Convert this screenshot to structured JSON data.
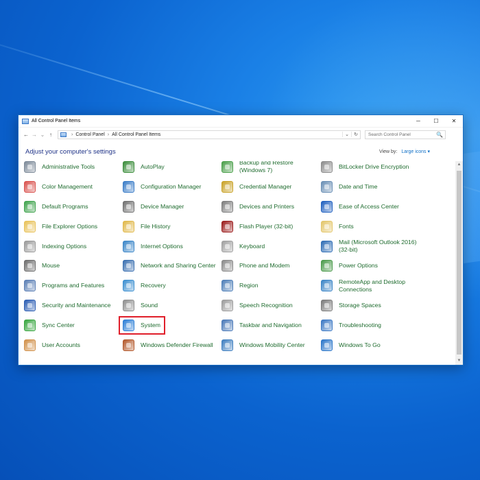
{
  "window": {
    "title": "All Control Panel Items",
    "controls": {
      "minimize": "─",
      "maximize": "☐",
      "close": "✕"
    }
  },
  "addressbar": {
    "back": "←",
    "forward": "→",
    "recent": "⌄",
    "up": "↑",
    "breadcrumbs": [
      "Control Panel",
      "All Control Panel Items"
    ],
    "dropdown": "⌄",
    "refresh": "↻",
    "search_placeholder": "Search Control Panel",
    "search_icon": "🔍"
  },
  "header": {
    "adjust_text": "Adjust your computer's settings",
    "view_by_label": "View by:",
    "view_by_value": "Large icons ▾"
  },
  "items": [
    {
      "label": "Administrative Tools",
      "icon": "admin-tools-icon",
      "color": "#7d8a99"
    },
    {
      "label": "AutoPlay",
      "icon": "autoplay-icon",
      "color": "#3b8d3b"
    },
    {
      "label": "Backup and Restore (Windows 7)",
      "icon": "backup-icon",
      "color": "#4a9f4a"
    },
    {
      "label": "BitLocker Drive Encryption",
      "icon": "bitlocker-icon",
      "color": "#8c8c8c"
    },
    {
      "label": "Color Management",
      "icon": "color-management-icon",
      "color": "#d9534f"
    },
    {
      "label": "Configuration Manager",
      "icon": "config-manager-icon",
      "color": "#3a7cc7"
    },
    {
      "label": "Credential Manager",
      "icon": "credential-manager-icon",
      "color": "#c9a227"
    },
    {
      "label": "Date and Time",
      "icon": "date-time-icon",
      "color": "#6a8fb5"
    },
    {
      "label": "Default Programs",
      "icon": "default-programs-icon",
      "color": "#3fa34d"
    },
    {
      "label": "Device Manager",
      "icon": "device-manager-icon",
      "color": "#6f6f6f"
    },
    {
      "label": "Devices and Printers",
      "icon": "devices-printers-icon",
      "color": "#7d7d7d"
    },
    {
      "label": "Ease of Access Center",
      "icon": "ease-of-access-icon",
      "color": "#1f5fbf"
    },
    {
      "label": "File Explorer Options",
      "icon": "folder-options-icon",
      "color": "#e8c25a"
    },
    {
      "label": "File History",
      "icon": "file-history-icon",
      "color": "#e0b84a"
    },
    {
      "label": "Flash Player (32-bit)",
      "icon": "flash-player-icon",
      "color": "#9b1c1c"
    },
    {
      "label": "Fonts",
      "icon": "fonts-icon",
      "color": "#e3c66a"
    },
    {
      "label": "Indexing Options",
      "icon": "indexing-icon",
      "color": "#9a9a9a"
    },
    {
      "label": "Internet Options",
      "icon": "internet-options-icon",
      "color": "#3b86c8"
    },
    {
      "label": "Keyboard",
      "icon": "keyboard-icon",
      "color": "#a0a0a0"
    },
    {
      "label": "Mail (Microsoft Outlook 2016) (32-bit)",
      "icon": "mail-icon",
      "color": "#2f6db5"
    },
    {
      "label": "Mouse",
      "icon": "mouse-icon",
      "color": "#6d6d6d"
    },
    {
      "label": "Network and Sharing Center",
      "icon": "network-icon",
      "color": "#3a6fb0"
    },
    {
      "label": "Phone and Modem",
      "icon": "phone-modem-icon",
      "color": "#8a8a8a"
    },
    {
      "label": "Power Options",
      "icon": "power-options-icon",
      "color": "#4a9a4a"
    },
    {
      "label": "Programs and Features",
      "icon": "programs-features-icon",
      "color": "#5b7fb5"
    },
    {
      "label": "Recovery",
      "icon": "recovery-icon",
      "color": "#3c8fd0"
    },
    {
      "label": "Region",
      "icon": "region-icon",
      "color": "#4e7fb8"
    },
    {
      "label": "RemoteApp and Desktop Connections",
      "icon": "remoteapp-icon",
      "color": "#3a84c6"
    },
    {
      "label": "Security and Maintenance",
      "icon": "security-flag-icon",
      "color": "#2b5db3"
    },
    {
      "label": "Sound",
      "icon": "sound-icon",
      "color": "#8f8f8f"
    },
    {
      "label": "Speech Recognition",
      "icon": "speech-icon",
      "color": "#9c9c9c"
    },
    {
      "label": "Storage Spaces",
      "icon": "storage-spaces-icon",
      "color": "#7a7a7a"
    },
    {
      "label": "Sync Center",
      "icon": "sync-center-icon",
      "color": "#37a63f"
    },
    {
      "label": "System",
      "icon": "system-icon",
      "color": "#2d7fd6",
      "highlighted": true
    },
    {
      "label": "Taskbar and Navigation",
      "icon": "taskbar-icon",
      "color": "#4a79b8"
    },
    {
      "label": "Troubleshooting",
      "icon": "troubleshooting-icon",
      "color": "#3b78c4"
    },
    {
      "label": "User Accounts",
      "icon": "user-accounts-icon",
      "color": "#d1914b"
    },
    {
      "label": "Windows Defender Firewall",
      "icon": "firewall-icon",
      "color": "#b3582b"
    },
    {
      "label": "Windows Mobility Center",
      "icon": "mobility-center-icon",
      "color": "#3f7fc0"
    },
    {
      "label": "Windows To Go",
      "icon": "windows-to-go-icon",
      "color": "#2b76c9"
    }
  ],
  "scrollbar": {
    "up": "▲",
    "down": "▼"
  },
  "colors": {
    "link_green": "#1e6b2e",
    "heading_blue": "#1e3287",
    "accent_blue": "#0f6fc6",
    "highlight_red": "#e01e2a"
  }
}
